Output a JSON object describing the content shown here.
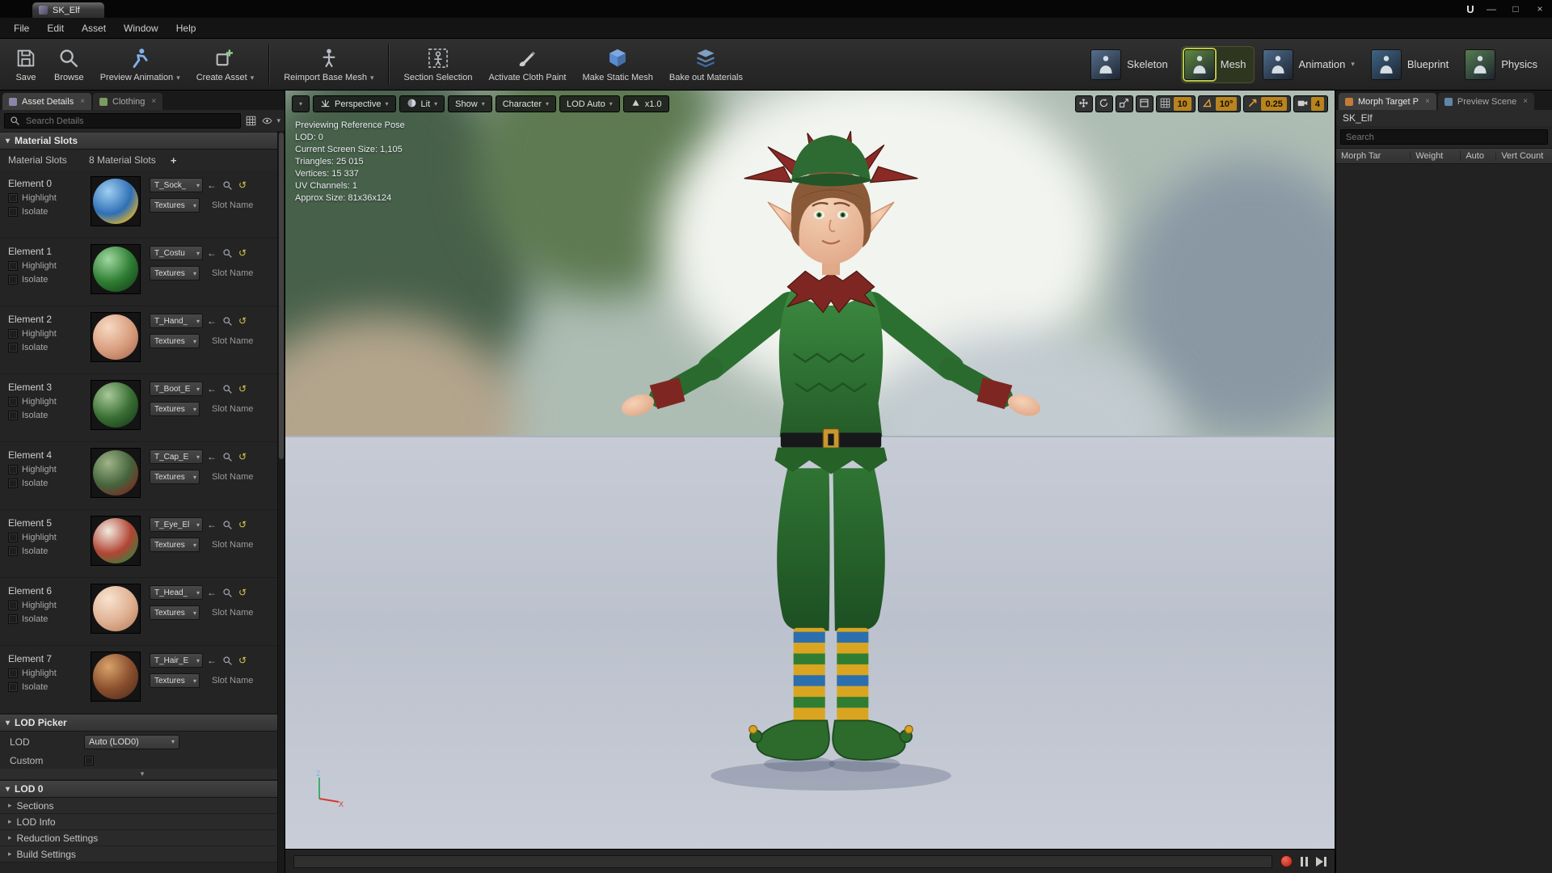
{
  "window": {
    "tab_title": "SK_Elf"
  },
  "icons": {
    "caret_down": "▾",
    "caret_right": "▸",
    "close_tab": "×",
    "plus": "+",
    "back_arrow": "←",
    "reset": "↺",
    "minimize": "—",
    "maximize": "□",
    "close": "×"
  },
  "menu_bar": {
    "items": [
      "File",
      "Edit",
      "Asset",
      "Window",
      "Help"
    ]
  },
  "toolbar": {
    "buttons": [
      {
        "label": "Save",
        "icon": "save",
        "dropdown": false,
        "group": 1
      },
      {
        "label": "Browse",
        "icon": "browse",
        "dropdown": false,
        "group": 1
      },
      {
        "label": "Preview Animation",
        "icon": "preview-animation",
        "dropdown": true,
        "group": 1
      },
      {
        "label": "Create Asset",
        "icon": "create-asset",
        "dropdown": true,
        "group": 1
      },
      {
        "label": "Reimport Base Mesh",
        "icon": "reimport",
        "dropdown": true,
        "group": 2
      },
      {
        "label": "Section Selection",
        "icon": "section-selection",
        "dropdown": false,
        "group": 3
      },
      {
        "label": "Activate Cloth Paint",
        "icon": "cloth-paint",
        "dropdown": false,
        "group": 3
      },
      {
        "label": "Make Static Mesh",
        "icon": "static-mesh",
        "dropdown": false,
        "group": 3
      },
      {
        "label": "Bake out Materials",
        "icon": "bake-materials",
        "dropdown": false,
        "group": 3
      }
    ],
    "modes": [
      {
        "label": "Skeleton",
        "tint": "#55708c",
        "active": false,
        "dropdown": false
      },
      {
        "label": "Mesh",
        "tint": "#5f8a3f",
        "active": true,
        "dropdown": false
      },
      {
        "label": "Animation",
        "tint": "#4e6a88",
        "active": false,
        "dropdown": true
      },
      {
        "label": "Blueprint",
        "tint": "#3f6484",
        "active": false,
        "dropdown": false
      },
      {
        "label": "Physics",
        "tint": "#567c50",
        "active": false,
        "dropdown": false
      }
    ]
  },
  "left_panel": {
    "tabs": [
      {
        "label": "Asset Details",
        "active": true
      },
      {
        "label": "Clothing",
        "active": false
      }
    ],
    "search_placeholder": "Search Details",
    "material_slots": {
      "section": "Material Slots",
      "slots_label": "Material Slots",
      "slots_count": "8 Material Slots",
      "labels": {
        "highlight": "Highlight",
        "isolate": "Isolate",
        "textures": "Textures",
        "slot_name": "Slot Name"
      },
      "elements": [
        {
          "name": "Element 0",
          "material": "T_Sock_",
          "ball": {
            "hi": "#9fd0f0",
            "main": "#2f6fb6",
            "accent": "#e4b62a"
          }
        },
        {
          "name": "Element 1",
          "material": "T_Costu",
          "ball": {
            "hi": "#9fd8a0",
            "main": "#2f7d33",
            "accent": "#1b4d1e"
          }
        },
        {
          "name": "Element 2",
          "material": "T_Hand_",
          "ball": {
            "hi": "#f6d9c2",
            "main": "#d99f80",
            "accent": "#b5765a"
          }
        },
        {
          "name": "Element 3",
          "material": "T_Boot_E",
          "ball": {
            "hi": "#a8c89a",
            "main": "#3a6f33",
            "accent": "#1e4420"
          }
        },
        {
          "name": "Element 4",
          "material": "T_Cap_E",
          "ball": {
            "hi": "#9fb486",
            "main": "#45633c",
            "accent": "#7a2d24"
          }
        },
        {
          "name": "Element 5",
          "material": "T_Eye_El",
          "ball": {
            "hi": "#f0ece0",
            "main": "#b24434",
            "accent": "#3f7d3a"
          }
        },
        {
          "name": "Element 6",
          "material": "T_Head_",
          "ball": {
            "hi": "#f8e3cf",
            "main": "#e0b294",
            "accent": "#c08a68"
          }
        },
        {
          "name": "Element 7",
          "material": "T_Hair_E",
          "ball": {
            "hi": "#d9a26a",
            "main": "#8a4f2e",
            "accent": "#5e3420"
          }
        }
      ]
    },
    "lod_picker": {
      "section": "LOD Picker",
      "lod_label": "LOD",
      "lod_value": "Auto (LOD0)",
      "custom_label": "Custom"
    },
    "lod0": {
      "section": "LOD 0",
      "rows": [
        "Sections",
        "LOD Info",
        "Reduction Settings",
        "Build Settings"
      ]
    }
  },
  "viewport": {
    "toolbar": {
      "perspective": "Perspective",
      "lit": "Lit",
      "show": "Show",
      "character": "Character",
      "lod": "LOD Auto",
      "speed": "x1.0"
    },
    "snaps": {
      "grid": "10",
      "angle": "10°",
      "scale": "0.25",
      "camera_speed": "4"
    },
    "stats": [
      "Previewing Reference Pose",
      "LOD: 0",
      "Current Screen Size: 1,105",
      "Triangles: 25 015",
      "Vertices: 15 337",
      "UV Channels: 1",
      "Approx Size: 81x36x124"
    ],
    "axis": {
      "z": "Z",
      "x": "X"
    },
    "character_palette": {
      "tunic": "#2f7d33",
      "tunic_dark": "#266128",
      "pants": "#2b6d30",
      "hat": "#2e6b33",
      "leaf": "#8a2a26",
      "skin": "#ecbd9d",
      "hair": "#8a5a38",
      "belt": "#17181a",
      "buckle": "#c9972f",
      "sock_yellow": "#d9a520",
      "sock_green": "#2f7d33",
      "sock_blue": "#2b6fae",
      "shoe": "#2d6b2d",
      "eye_green": "#3f7d3a"
    }
  },
  "right_panel": {
    "tabs": [
      {
        "label": "Morph Target P",
        "active": true
      },
      {
        "label": "Preview Scene",
        "active": false
      }
    ],
    "asset_name": "SK_Elf",
    "search_placeholder": "Search",
    "columns": [
      "Morph Tar",
      "Weight",
      "Auto",
      "Vert Count"
    ]
  }
}
